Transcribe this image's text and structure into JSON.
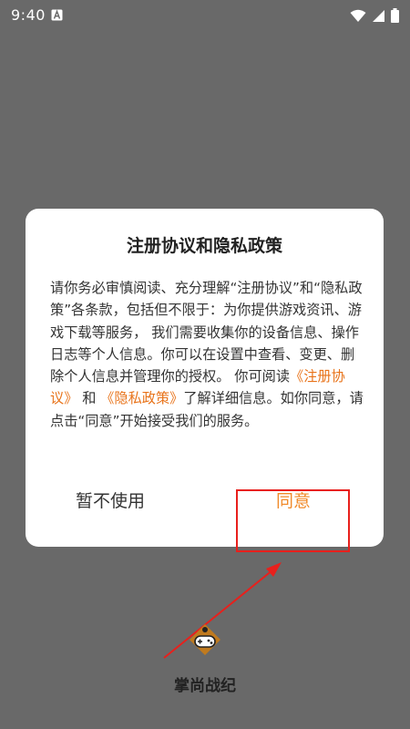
{
  "status_bar": {
    "time": "9:40",
    "notification_icon": "a-letter-icon",
    "wifi_icon": "wifi-icon",
    "signal_icon": "cell-signal-icon",
    "battery_icon": "battery-icon"
  },
  "dialog": {
    "title": "注册协议和隐私政策",
    "body_before": "请你务必审慎阅读、充分理解“注册协议”和“隐私政策”各条款，包括但不限于：为你提供游戏资讯、游戏下载等服务， 我们需要收集你的设备信息、操作日志等个人信息。你可以在设置中查看、变更、删除个人信息并管理你的授权。 你可阅读",
    "link_agreement": "《注册协议》",
    "and_text": " 和 ",
    "link_privacy": "《隐私政策》",
    "body_after": "了解详细信息。如你同意，请点击“同意”开始接受我们的服务。",
    "decline_label": "暂不使用",
    "agree_label": "同意",
    "link_color": "#e8731a",
    "agree_color": "#f08a2a"
  },
  "annotation": {
    "box_color": "#e8201c"
  },
  "app": {
    "logo_icon": "gamepad-icon",
    "name": "掌尚战纪"
  }
}
